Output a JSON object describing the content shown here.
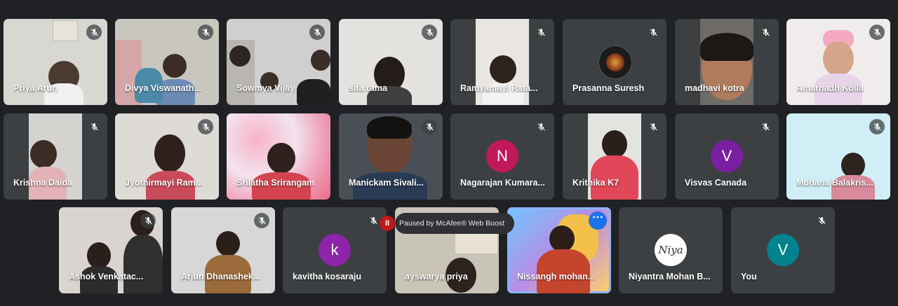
{
  "colors": {
    "background": "#202124",
    "tile": "#3c4043",
    "accent": "#1a73e8",
    "mic_muted": "#ffffff"
  },
  "participants": [
    {
      "name": "Priya Arun",
      "muted": true
    },
    {
      "name": "Divya Viswanath...",
      "muted": true
    },
    {
      "name": "Sowmya Vijay",
      "muted": true
    },
    {
      "name": "sita rama",
      "muted": true
    },
    {
      "name": "Ramyamayi Rata...",
      "muted": true
    },
    {
      "name": "Prasanna Suresh",
      "muted": true,
      "avatar": "profile-photo"
    },
    {
      "name": "madhavi kotra",
      "muted": true
    },
    {
      "name": "Amarnadh Kolla",
      "muted": true
    },
    {
      "name": "Krishna Daida",
      "muted": true
    },
    {
      "name": "Jyothirmayi Ram...",
      "muted": true
    },
    {
      "name": "Srilatha Srirangam",
      "muted": false
    },
    {
      "name": "Manickam Sivali...",
      "muted": true
    },
    {
      "name": "Nagarajan Kumara...",
      "muted": true,
      "initial": "N",
      "avatar_color": "#c2185b"
    },
    {
      "name": "Krithika K7",
      "muted": true
    },
    {
      "name": "Visvas Canada",
      "muted": true,
      "initial": "V",
      "avatar_color": "#7b1fa2"
    },
    {
      "name": "Mohana Balakris...",
      "muted": true
    },
    {
      "name": "Ashok Venkatac...",
      "muted": true
    },
    {
      "name": "Arjun Dhanashek...",
      "muted": true
    },
    {
      "name": "kavitha kosaraju",
      "muted": true,
      "initial": "k",
      "avatar_color": "#8e24aa"
    },
    {
      "name": "ayswarya priya",
      "muted": false
    },
    {
      "name": "Nissangh mohan...",
      "muted": false,
      "active_speaker": true
    },
    {
      "name": "Niyantra Mohan B...",
      "muted": false,
      "logo_text": "Niya"
    },
    {
      "name": "You",
      "muted": true,
      "initial": "V",
      "avatar_color": "#00838f"
    }
  ],
  "overlay": {
    "label": "Paused by McAfee® Web Boost",
    "icon": "pause-icon"
  }
}
